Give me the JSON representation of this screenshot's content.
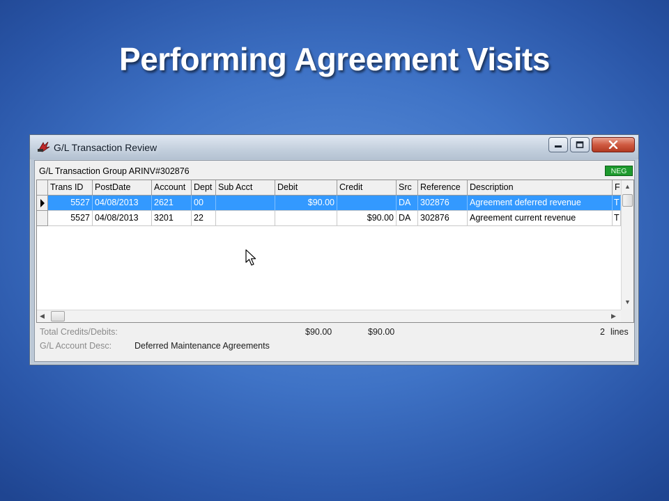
{
  "slide": {
    "title": "Performing Agreement Visits"
  },
  "window": {
    "title": "G/L Transaction Review",
    "group_label": "G/L Transaction Group ARINV#302876",
    "badge": "NEG"
  },
  "grid": {
    "columns": [
      "Trans ID",
      "PostDate",
      "Account",
      "Dept",
      "Sub Acct",
      "Debit",
      "Credit",
      "Src",
      "Reference",
      "Description",
      "F"
    ],
    "rows": [
      {
        "trans_id": "5527",
        "post_date": "04/08/2013",
        "account": "2621",
        "dept": "00",
        "sub_acct": "",
        "debit": "$90.00",
        "credit": "",
        "src": "DA",
        "reference": "302876",
        "description": "Agreement deferred revenue",
        "f": "T",
        "selected": true
      },
      {
        "trans_id": "5527",
        "post_date": "04/08/2013",
        "account": "3201",
        "dept": "22",
        "sub_acct": "",
        "debit": "",
        "credit": "$90.00",
        "src": "DA",
        "reference": "302876",
        "description": "Agreement current revenue",
        "f": "T",
        "selected": false
      }
    ]
  },
  "footer": {
    "totals_label": "Total Credits/Debits:",
    "total_debit": "$90.00",
    "total_credit": "$90.00",
    "line_count": "2",
    "lines_label": "lines",
    "account_desc_label": "G/L Account Desc:",
    "account_desc_value": "Deferred Maintenance Agreements"
  },
  "colors": {
    "selection": "#3399ff",
    "badge": "#1e9a2e",
    "close_button": "#cf5a41"
  }
}
